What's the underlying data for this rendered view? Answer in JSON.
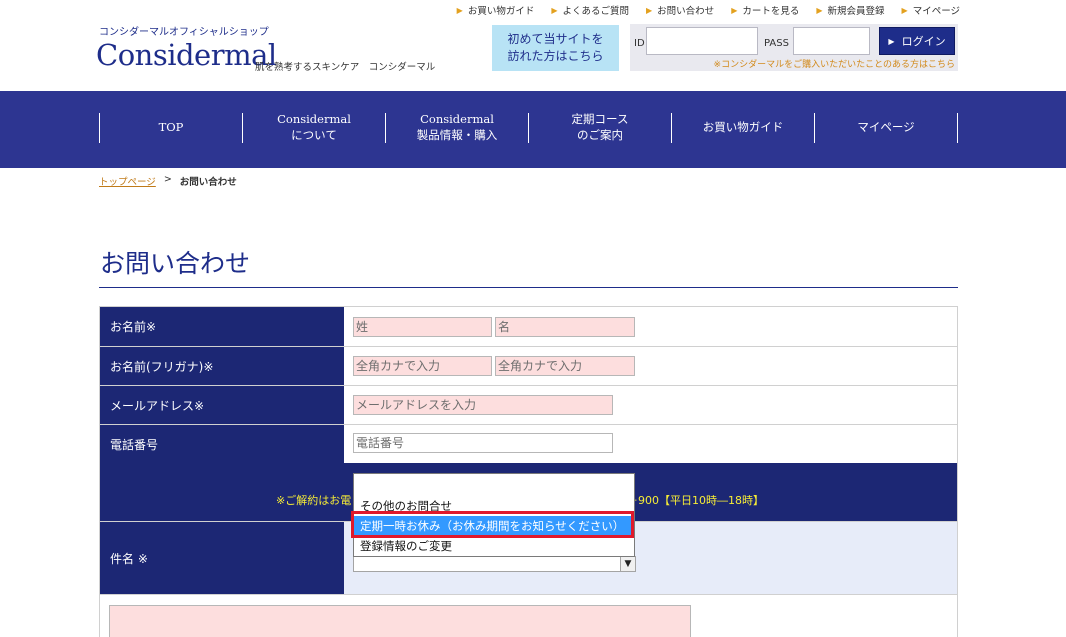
{
  "top_links": [
    "お買い物ガイド",
    "よくあるご質問",
    "お問い合わせ",
    "カートを見る",
    "新規会員登録",
    "マイページ"
  ],
  "brand": {
    "tagline": "コンシダーマルオフィシャルショップ",
    "logo": "Considermal",
    "sub": "肌を熟考するスキンケア　コンシダーマル"
  },
  "first_visit": {
    "line1": "初めて当サイトを",
    "line2": "訪れた方はこちら"
  },
  "login": {
    "id_label": "ID",
    "pass_label": "PASS",
    "button": "ログイン",
    "note": "※コンシダーマルをご購入いただいたことのある方はこちら"
  },
  "nav": [
    "TOP",
    "Considermal\nについて",
    "Considermal\n製品情報・購入",
    "定期コース\nのご案内",
    "お買い物ガイド",
    "マイページ"
  ],
  "breadcrumb": {
    "home": "トップページ",
    "sep": ">",
    "current": "お問い合わせ"
  },
  "page_title": "お問い合わせ",
  "form": {
    "name_label": "お名前※",
    "name_last_ph": "姓",
    "name_first_ph": "名",
    "kana_label": "お名前(フリガナ)※",
    "kana_last_ph": "全角カナで入力",
    "kana_first_ph": "全角カナで入力",
    "email_label": "メールアドレス※",
    "email_ph": "メールアドレスを入力",
    "phone_label": "電話番号",
    "phone_ph": "電話番号",
    "notice_left": "※ご解約はお電",
    "notice_right": "9－900【平日10時―18時】",
    "subject_label": "件名 ※",
    "subject_options": [
      "その他のお問合せ",
      "定期一時お休み（お休み期間をお知らせください）",
      "登録情報のご変更"
    ],
    "subject_selected_index": 1
  },
  "colors": {
    "brand_navy": "#1e2d8a",
    "nav_bg": "#2d3591",
    "label_bg": "#1c2774",
    "required_bg": "#fddede",
    "link_orange": "#c07a18",
    "notice_yellow": "#f6ec36",
    "highlight_red": "#e0192b",
    "option_selected": "#3399ff"
  },
  "icons": {
    "top_link_marker": "triangle-right-icon",
    "login_marker": "triangle-right-icon",
    "select_toggle": "chevron-down-icon"
  }
}
